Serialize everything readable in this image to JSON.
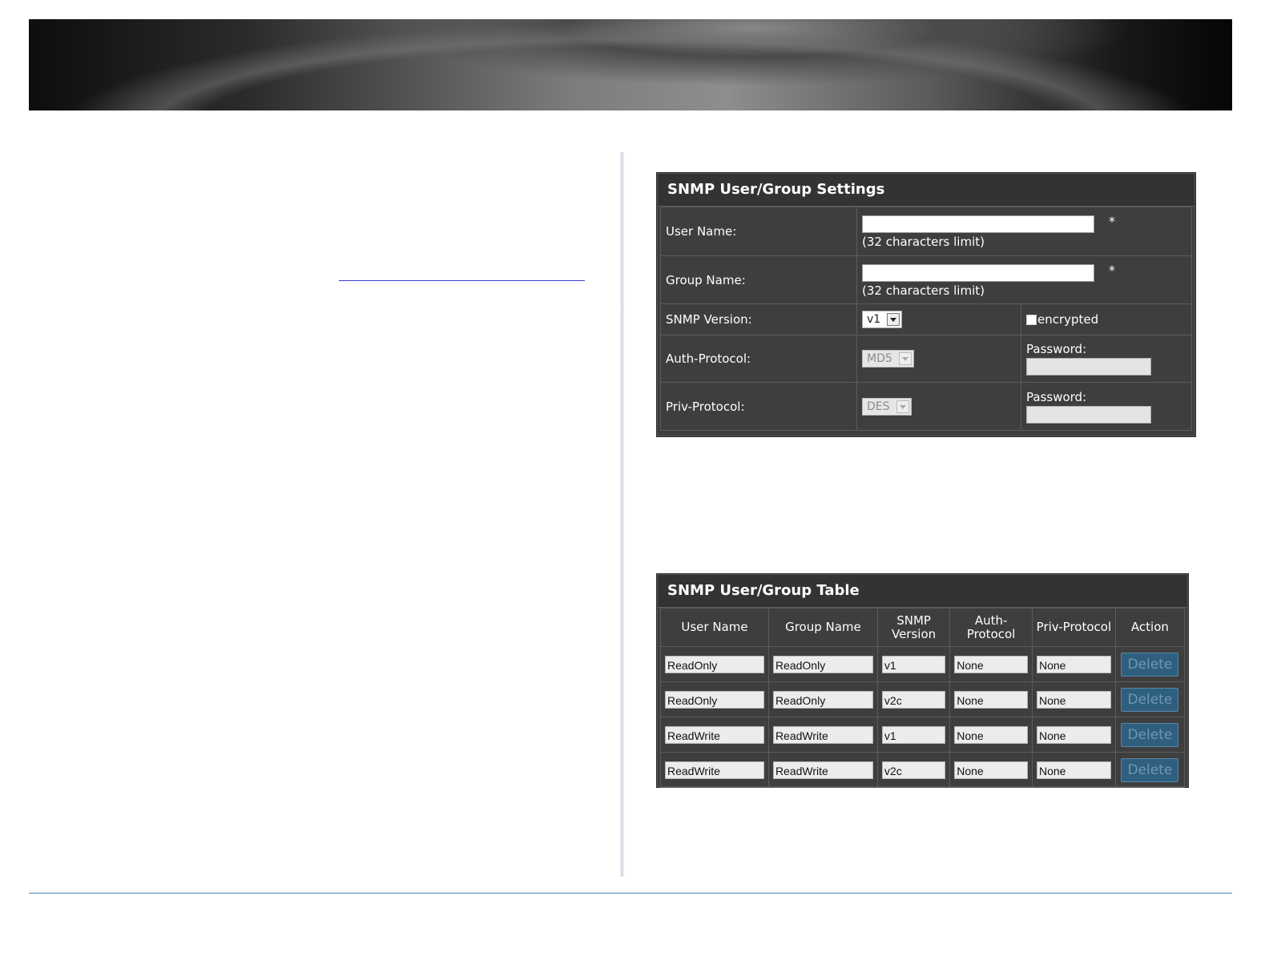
{
  "settings": {
    "title": "SNMP User/Group Settings",
    "user_name": {
      "label": "User Name:",
      "value": "",
      "hint": "(32 characters limit)",
      "required": "*"
    },
    "group_name": {
      "label": "Group Name:",
      "value": "",
      "hint": "(32 characters limit)",
      "required": "*"
    },
    "snmp_version": {
      "label": "SNMP Version:",
      "selected": "v1",
      "encrypted_label": "encrypted"
    },
    "auth_protocol": {
      "label": "Auth-Protocol:",
      "selected": "MD5",
      "password_label": "Password:"
    },
    "priv_protocol": {
      "label": "Priv-Protocol:",
      "selected": "DES",
      "password_label": "Password:"
    }
  },
  "table": {
    "title": "SNMP User/Group Table",
    "headers": [
      "User Name",
      "Group Name",
      "SNMP Version",
      "Auth-Protocol",
      "Priv-Protocol",
      "Action"
    ],
    "header_lines": {
      "snmp_version": [
        "SNMP",
        "Version"
      ],
      "auth_protocol": [
        "Auth-",
        "Protocol"
      ]
    },
    "rows": [
      {
        "user": "ReadOnly",
        "group": "ReadOnly",
        "version": "v1",
        "auth": "None",
        "priv": "None",
        "action": "Delete"
      },
      {
        "user": "ReadOnly",
        "group": "ReadOnly",
        "version": "v2c",
        "auth": "None",
        "priv": "None",
        "action": "Delete"
      },
      {
        "user": "ReadWrite",
        "group": "ReadWrite",
        "version": "v1",
        "auth": "None",
        "priv": "None",
        "action": "Delete"
      },
      {
        "user": "ReadWrite",
        "group": "ReadWrite",
        "version": "v2c",
        "auth": "None",
        "priv": "None",
        "action": "Delete"
      }
    ]
  },
  "colors": {
    "panel_bg": "#3e3e3e",
    "delete_button": "#2f5f7f",
    "footer_line": "#4a86c5",
    "link_line": "#3b3bd6"
  }
}
